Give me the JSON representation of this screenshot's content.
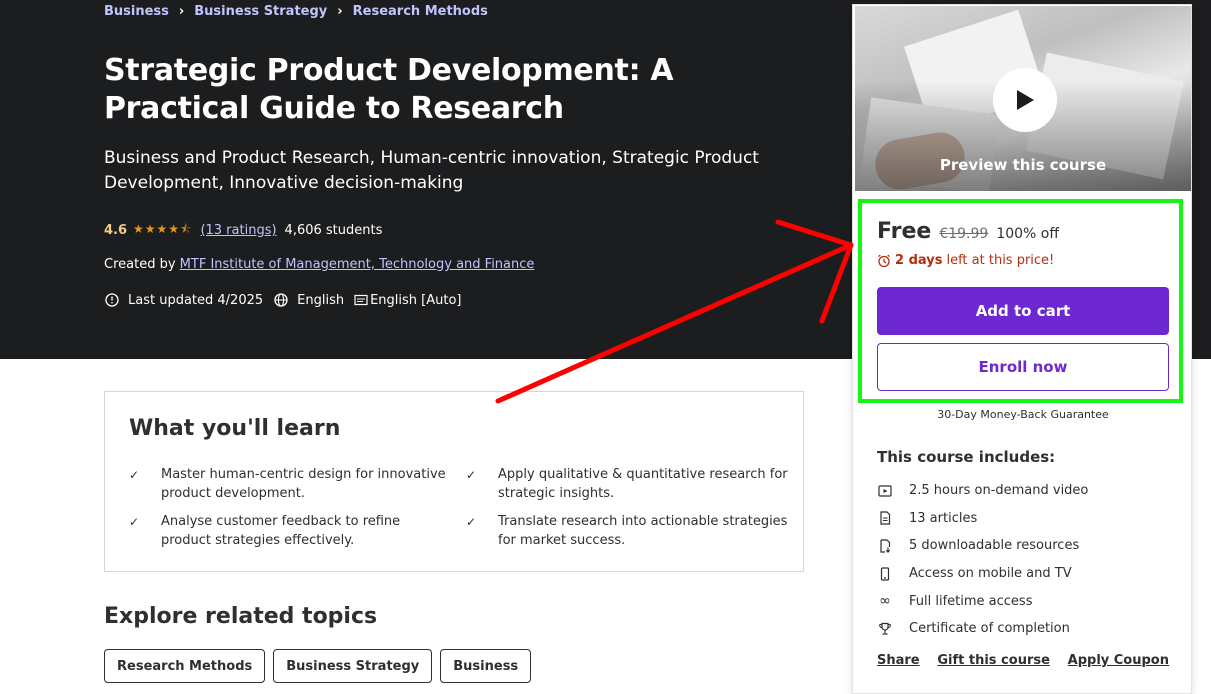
{
  "breadcrumb": [
    "Business",
    "Business Strategy",
    "Research Methods"
  ],
  "course": {
    "title": "Strategic Product Development: A Practical Guide to Research",
    "subtitle": "Business and Product Research, Human-centric innovation, Strategic Product Development, Innovative decision-making",
    "rating": "4.6",
    "stars_value": 4.6,
    "ratings_link": "(13 ratings)",
    "students": "4,606 students",
    "created_by_label": "Created by",
    "instructor": "MTF Institute of Management, Technology and Finance",
    "last_updated": "Last updated 4/2025",
    "language": "English",
    "captions": "English [Auto]"
  },
  "card": {
    "preview_label": "Preview this course",
    "price": "Free",
    "original_price": "€19.99",
    "discount": "100% off",
    "countdown_bold": "2 days",
    "countdown_rest": "left at this price!",
    "add_to_cart": "Add to cart",
    "enroll_now": "Enroll now",
    "guarantee": "30-Day Money-Back Guarantee",
    "includes_title": "This course includes:",
    "includes": [
      {
        "icon": "video-icon",
        "text": "2.5 hours on-demand video"
      },
      {
        "icon": "article-icon",
        "text": "13 articles"
      },
      {
        "icon": "download-file-icon",
        "text": "5 downloadable resources"
      },
      {
        "icon": "mobile-icon",
        "text": "Access on mobile and TV"
      },
      {
        "icon": "infinity-icon",
        "text": "Full lifetime access"
      },
      {
        "icon": "trophy-icon",
        "text": "Certificate of completion"
      }
    ],
    "links": [
      "Share",
      "Gift this course",
      "Apply Coupon"
    ]
  },
  "learn": {
    "title": "What you'll learn",
    "items": [
      "Master human-centric design for innovative product development.",
      "Apply qualitative & quantitative research for strategic insights.",
      "Analyse customer feedback to refine product strategies effectively.",
      "Translate research into actionable strategies for market success."
    ]
  },
  "related": {
    "title": "Explore related topics",
    "topics": [
      "Research Methods",
      "Business Strategy",
      "Business"
    ]
  },
  "colors": {
    "hero_bg": "#1c1d1f",
    "accent_purple": "#6d28d2",
    "link_lavender": "#c0c4fc",
    "rating_gold": "#f3ca8c",
    "star_orange": "#e59819",
    "urgency_red": "#b32d0f",
    "highlight_green": "#17f517",
    "annotation_arrow_red": "#ff0000"
  }
}
